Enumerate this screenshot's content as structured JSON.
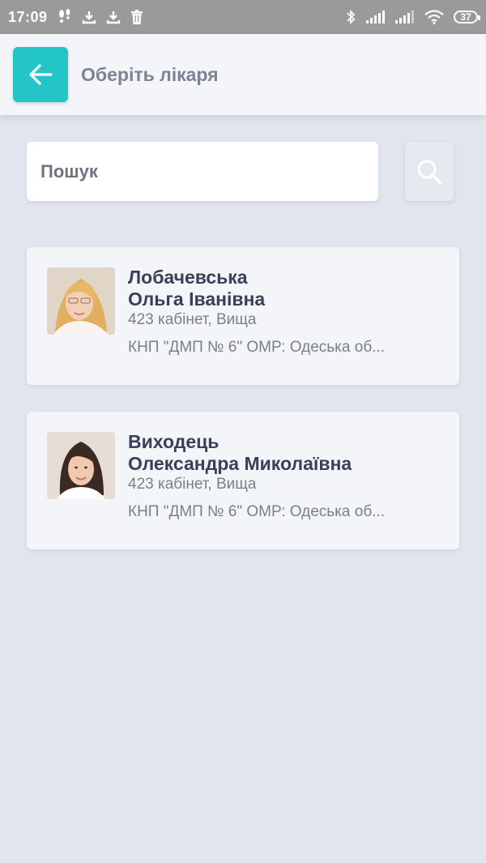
{
  "status_bar": {
    "time": "17:09",
    "battery": "37",
    "icons": [
      "footsteps-icon",
      "download-icon",
      "download-icon",
      "trash-icon",
      "bluetooth-icon",
      "signal-icon",
      "signal-icon",
      "wifi-icon",
      "battery-icon"
    ]
  },
  "header": {
    "title": "Оберіть лікаря",
    "back_icon": "arrow-left-icon"
  },
  "search": {
    "placeholder": "Пошук",
    "button_icon": "search-icon"
  },
  "doctors": [
    {
      "name_line1": "Лобачевська",
      "name_line2": "Ольга Іванівна",
      "cabinet": "423 кабінет, Вища",
      "org": "КНП \"ДМП № 6\" ОМР: Одеська об..."
    },
    {
      "name_line1": "Виходець",
      "name_line2": "Олександра Миколаївна",
      "cabinet": "423 кабінет, Вища",
      "org": "КНП \"ДМП № 6\" ОМР: Одеська об..."
    }
  ],
  "colors": {
    "accent": "#23c5c6",
    "background": "#e1e5ee",
    "card": "#f4f5f9",
    "name_text": "#394059",
    "secondary_text": "#7a7f8c"
  }
}
